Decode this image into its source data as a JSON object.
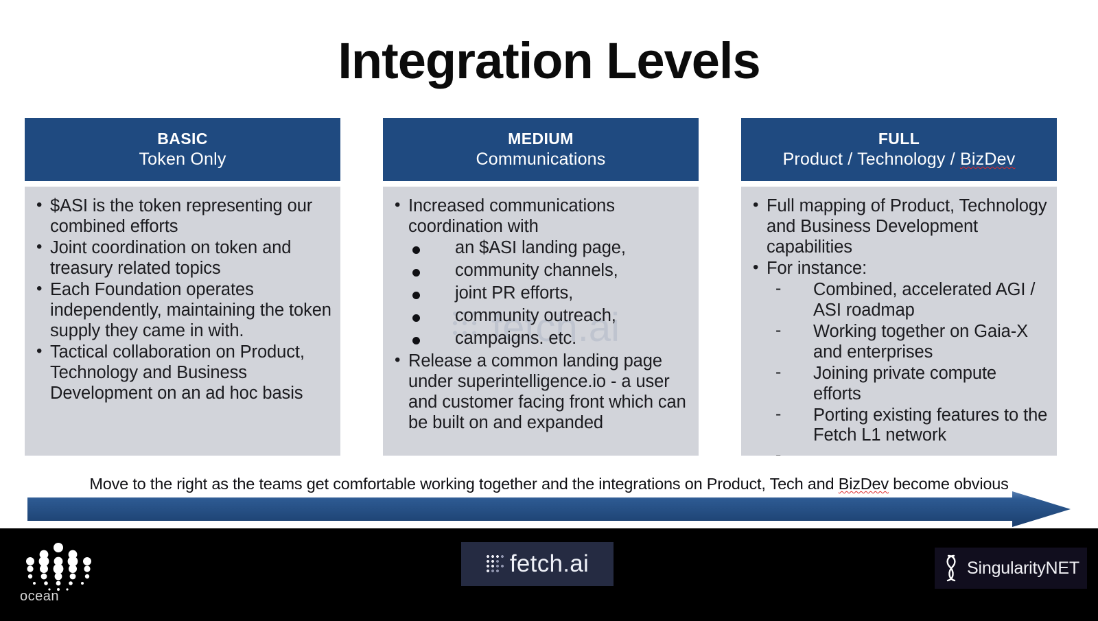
{
  "title": "Integration Levels",
  "columns": [
    {
      "level": "BASIC",
      "subtitle": "Token Only",
      "subtitle_misspelled": "",
      "bullets": [
        {
          "text": "$ASI is the token representing our combined efforts",
          "subs": []
        },
        {
          "text": "Joint coordination on token and treasury related topics",
          "subs": []
        },
        {
          "text": "Each Foundation operates independently, maintaining the token supply they came in with.",
          "subs": []
        },
        {
          "text": "Tactical collaboration on Product, Technology and Business Development on an ad hoc basis",
          "subs": []
        }
      ]
    },
    {
      "level": "MEDIUM",
      "subtitle": "Communications",
      "subtitle_misspelled": "",
      "bullets": [
        {
          "text": "Increased communications coordination with",
          "sub_marker": "dot",
          "subs": [
            "an $ASI landing page,",
            "community channels,",
            "joint PR efforts,",
            "community outreach,",
            "campaigns. etc."
          ]
        },
        {
          "text": "Release a common landing page under superintelligence.io - a user and customer facing front which can be built on and expanded",
          "subs": []
        }
      ]
    },
    {
      "level": "FULL",
      "subtitle": "Product / Technology / ",
      "subtitle_misspelled": "BizDev",
      "bullets": [
        {
          "text": "Full mapping of Product, Technology and Business Development capabilities",
          "subs": []
        },
        {
          "text": "For instance:",
          "sub_marker": "dash",
          "subs": [
            "Combined, accelerated AGI / ASI roadmap",
            "Working together on Gaia-X and enterprises",
            "Joining private compute efforts",
            "Porting existing features to the Fetch L1 network",
            ""
          ]
        }
      ]
    }
  ],
  "caption": {
    "before": "Move to the right as the teams get comfortable working together and the integrations on Product, Tech and ",
    "misspelled": "BizDev",
    "after": " become obvious"
  },
  "watermark": {
    "text": "fetch.ai"
  },
  "footer": {
    "ocean_label": "ocean",
    "fetch_label": "fetch.ai",
    "singularitynet_label": "SingularityNET"
  },
  "colors": {
    "header_blue": "#1f4a80",
    "panel_gray": "#d2d4da",
    "arrow_blue": "#1f4a80",
    "arrow_blue_light": "#4a73a8",
    "spellcheck_red": "#e02b2b",
    "footer_black": "#000000"
  }
}
